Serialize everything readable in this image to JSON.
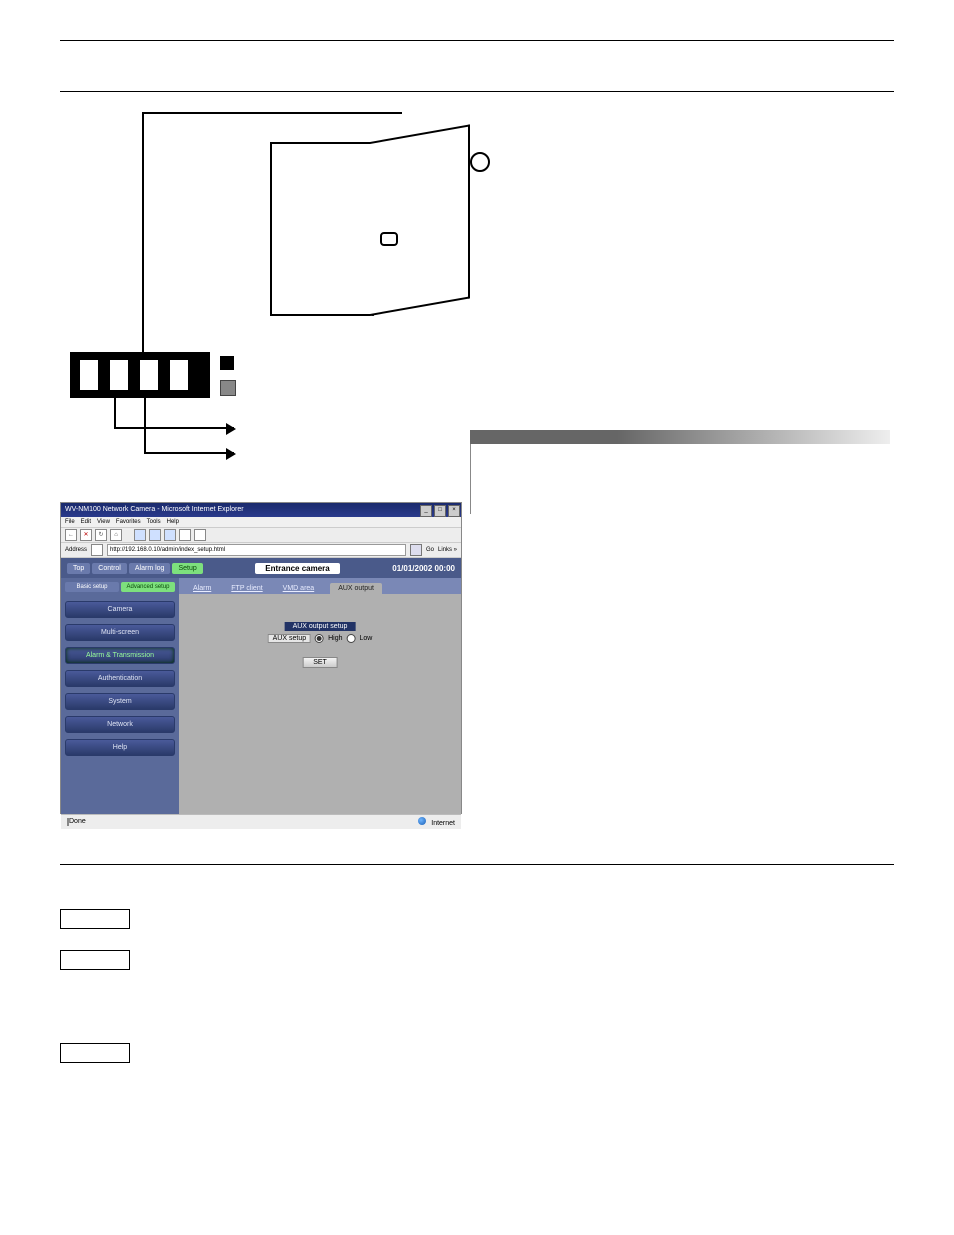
{
  "browser": {
    "title": "WV-NM100 Network Camera - Microsoft Internet Explorer",
    "menus": [
      "File",
      "Edit",
      "View",
      "Favorites",
      "Tools",
      "Help"
    ],
    "address_label": "Address",
    "address_value": "http://192.168.0.10/admin/index_setup.html",
    "go_label": "Go",
    "links_label": "Links »",
    "status_left": "Done",
    "status_right": "Internet"
  },
  "camera_ui": {
    "toptabs": {
      "top": "Top",
      "control": "Control",
      "alarmlog": "Alarm log",
      "setup": "Setup"
    },
    "title_center": "Entrance  camera",
    "datetime": "01/01/2002  00:00",
    "side_tabs": {
      "basic": "Basic setup",
      "advanced": "Advanced setup"
    },
    "side_buttons": {
      "camera": "Camera",
      "multiscreen": "Multi-screen",
      "alarm_trans": "Alarm & Transmission",
      "authentication": "Authentication",
      "system": "System",
      "network": "Network",
      "help": "Help"
    },
    "tabs": {
      "alarm": "Alarm",
      "ftp_client": "FTP client",
      "vmd_area": "VMD area",
      "aux_output": "AUX output"
    },
    "panel": {
      "heading": "AUX output setup",
      "label": "AUX setup",
      "high": "High",
      "low": "Low",
      "set": "SET"
    }
  },
  "steps": {
    "s1": "",
    "s2": "",
    "s3": ""
  }
}
